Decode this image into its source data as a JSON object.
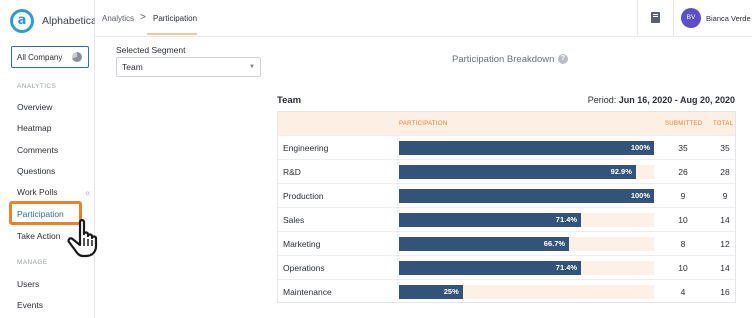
{
  "brand": {
    "name": "Alphabetical",
    "logo_letter": "a"
  },
  "company_selector": {
    "label": "All Company",
    "icon": "pie-chart-icon"
  },
  "sidebar": {
    "analytics_label": "ANALYTICS",
    "analytics_items": [
      {
        "label": "Overview"
      },
      {
        "label": "Heatmap"
      },
      {
        "label": "Comments"
      },
      {
        "label": "Questions"
      },
      {
        "label": "Work Polls"
      },
      {
        "label": "Participation",
        "active": true
      },
      {
        "label": "Take Action"
      }
    ],
    "manage_label": "MANAGE",
    "manage_items": [
      {
        "label": "Users"
      },
      {
        "label": "Events"
      }
    ],
    "collapse_icon": "double-chevron-left-icon"
  },
  "topbar": {
    "breadcrumb": [
      "Analytics",
      "Participation"
    ],
    "separator": ">",
    "help_icon": "book-icon",
    "user": {
      "initials": "BV",
      "name": "Bianca Verde"
    }
  },
  "segment": {
    "label": "Selected Segment",
    "value": "Team",
    "caret": "▼"
  },
  "breakdown": {
    "title": "Participation Breakdown",
    "help": "?"
  },
  "table": {
    "title": "Team",
    "period_label": "Period:",
    "period_value": "Jun 16, 2020 - Aug 20, 2020",
    "columns": {
      "participation": "PARTICIPATION",
      "submitted": "SUBMITTED",
      "total": "TOTAL"
    },
    "rows": [
      {
        "name": "Engineering",
        "participation": 1.0,
        "pct_label": "100%",
        "submitted": "35",
        "total": "35"
      },
      {
        "name": "R&D",
        "participation": 0.929,
        "pct_label": "92.9%",
        "submitted": "26",
        "total": "28"
      },
      {
        "name": "Production",
        "participation": 1.0,
        "pct_label": "100%",
        "submitted": "9",
        "total": "9"
      },
      {
        "name": "Sales",
        "participation": 0.714,
        "pct_label": "71.4%",
        "submitted": "10",
        "total": "14"
      },
      {
        "name": "Marketing",
        "participation": 0.667,
        "pct_label": "66.7%",
        "submitted": "8",
        "total": "12"
      },
      {
        "name": "Operations",
        "participation": 0.714,
        "pct_label": "71.4%",
        "submitted": "10",
        "total": "14"
      },
      {
        "name": "Maintenance",
        "participation": 0.25,
        "pct_label": "25%",
        "submitted": "4",
        "total": "16"
      }
    ]
  },
  "colors": {
    "accent": "#e9822b",
    "bar": "#34537a",
    "link": "#2f6bb8",
    "logo": "#2f9bd6"
  }
}
